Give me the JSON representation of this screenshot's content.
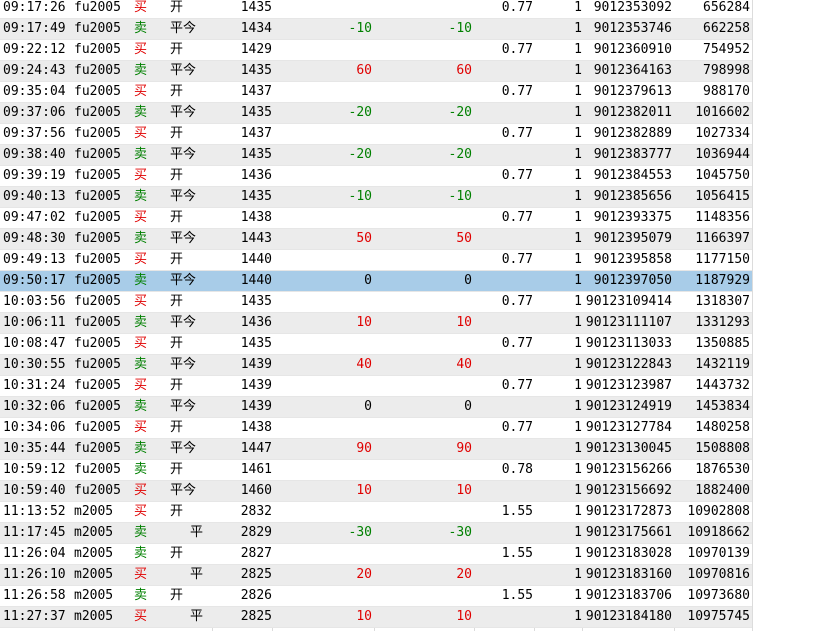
{
  "columns_visible": [
    "time",
    "symbol",
    "direction",
    "action",
    "price",
    "change_a",
    "change_b",
    "fee",
    "qty",
    "order_id",
    "cumulative"
  ],
  "colors": {
    "buy": "#e00000",
    "sell": "#008000",
    "selected_row": "#a8cce8",
    "stripe": "#ececec"
  },
  "rows": [
    {
      "time": "09:17:26",
      "symbol": "fu2005",
      "dir": "买",
      "act": "开",
      "price": "1435",
      "chg1": "",
      "chg2": "",
      "fee": "0.77",
      "qty": "1",
      "oid": "9012353092",
      "acc": "656284"
    },
    {
      "time": "09:17:49",
      "symbol": "fu2005",
      "dir": "卖",
      "act": "平今",
      "price": "1434",
      "chg1": "-10",
      "chg2": "-10",
      "fee": "",
      "qty": "1",
      "oid": "9012353746",
      "acc": "662258"
    },
    {
      "time": "09:22:12",
      "symbol": "fu2005",
      "dir": "买",
      "act": "开",
      "price": "1429",
      "chg1": "",
      "chg2": "",
      "fee": "0.77",
      "qty": "1",
      "oid": "9012360910",
      "acc": "754952"
    },
    {
      "time": "09:24:43",
      "symbol": "fu2005",
      "dir": "卖",
      "act": "平今",
      "price": "1435",
      "chg1": "60",
      "chg2": "60",
      "fee": "",
      "qty": "1",
      "oid": "9012364163",
      "acc": "798998"
    },
    {
      "time": "09:35:04",
      "symbol": "fu2005",
      "dir": "买",
      "act": "开",
      "price": "1437",
      "chg1": "",
      "chg2": "",
      "fee": "0.77",
      "qty": "1",
      "oid": "9012379613",
      "acc": "988170"
    },
    {
      "time": "09:37:06",
      "symbol": "fu2005",
      "dir": "卖",
      "act": "平今",
      "price": "1435",
      "chg1": "-20",
      "chg2": "-20",
      "fee": "",
      "qty": "1",
      "oid": "9012382011",
      "acc": "1016602"
    },
    {
      "time": "09:37:56",
      "symbol": "fu2005",
      "dir": "买",
      "act": "开",
      "price": "1437",
      "chg1": "",
      "chg2": "",
      "fee": "0.77",
      "qty": "1",
      "oid": "9012382889",
      "acc": "1027334"
    },
    {
      "time": "09:38:40",
      "symbol": "fu2005",
      "dir": "卖",
      "act": "平今",
      "price": "1435",
      "chg1": "-20",
      "chg2": "-20",
      "fee": "",
      "qty": "1",
      "oid": "9012383777",
      "acc": "1036944"
    },
    {
      "time": "09:39:19",
      "symbol": "fu2005",
      "dir": "买",
      "act": "开",
      "price": "1436",
      "chg1": "",
      "chg2": "",
      "fee": "0.77",
      "qty": "1",
      "oid": "9012384553",
      "acc": "1045750"
    },
    {
      "time": "09:40:13",
      "symbol": "fu2005",
      "dir": "卖",
      "act": "平今",
      "price": "1435",
      "chg1": "-10",
      "chg2": "-10",
      "fee": "",
      "qty": "1",
      "oid": "9012385656",
      "acc": "1056415"
    },
    {
      "time": "09:47:02",
      "symbol": "fu2005",
      "dir": "买",
      "act": "开",
      "price": "1438",
      "chg1": "",
      "chg2": "",
      "fee": "0.77",
      "qty": "1",
      "oid": "9012393375",
      "acc": "1148356"
    },
    {
      "time": "09:48:30",
      "symbol": "fu2005",
      "dir": "卖",
      "act": "平今",
      "price": "1443",
      "chg1": "50",
      "chg2": "50",
      "fee": "",
      "qty": "1",
      "oid": "9012395079",
      "acc": "1166397"
    },
    {
      "time": "09:49:13",
      "symbol": "fu2005",
      "dir": "买",
      "act": "开",
      "price": "1440",
      "chg1": "",
      "chg2": "",
      "fee": "0.77",
      "qty": "1",
      "oid": "9012395858",
      "acc": "1177150"
    },
    {
      "time": "09:50:17",
      "symbol": "fu2005",
      "dir": "卖",
      "act": "平今",
      "price": "1440",
      "chg1": "0",
      "chg2": "0",
      "fee": "",
      "qty": "1",
      "oid": "9012397050",
      "acc": "1187929",
      "selected": true
    },
    {
      "time": "10:03:56",
      "symbol": "fu2005",
      "dir": "买",
      "act": "开",
      "price": "1435",
      "chg1": "",
      "chg2": "",
      "fee": "0.77",
      "qty": "1",
      "oid": "90123109414",
      "acc": "1318307"
    },
    {
      "time": "10:06:11",
      "symbol": "fu2005",
      "dir": "卖",
      "act": "平今",
      "price": "1436",
      "chg1": "10",
      "chg2": "10",
      "fee": "",
      "qty": "1",
      "oid": "90123111107",
      "acc": "1331293"
    },
    {
      "time": "10:08:47",
      "symbol": "fu2005",
      "dir": "买",
      "act": "开",
      "price": "1435",
      "chg1": "",
      "chg2": "",
      "fee": "0.77",
      "qty": "1",
      "oid": "90123113033",
      "acc": "1350885"
    },
    {
      "time": "10:30:55",
      "symbol": "fu2005",
      "dir": "卖",
      "act": "平今",
      "price": "1439",
      "chg1": "40",
      "chg2": "40",
      "fee": "",
      "qty": "1",
      "oid": "90123122843",
      "acc": "1432119"
    },
    {
      "time": "10:31:24",
      "symbol": "fu2005",
      "dir": "买",
      "act": "开",
      "price": "1439",
      "chg1": "",
      "chg2": "",
      "fee": "0.77",
      "qty": "1",
      "oid": "90123123987",
      "acc": "1443732"
    },
    {
      "time": "10:32:06",
      "symbol": "fu2005",
      "dir": "卖",
      "act": "平今",
      "price": "1439",
      "chg1": "0",
      "chg2": "0",
      "fee": "",
      "qty": "1",
      "oid": "90123124919",
      "acc": "1453834"
    },
    {
      "time": "10:34:06",
      "symbol": "fu2005",
      "dir": "买",
      "act": "开",
      "price": "1438",
      "chg1": "",
      "chg2": "",
      "fee": "0.77",
      "qty": "1",
      "oid": "90123127784",
      "acc": "1480258"
    },
    {
      "time": "10:35:44",
      "symbol": "fu2005",
      "dir": "卖",
      "act": "平今",
      "price": "1447",
      "chg1": "90",
      "chg2": "90",
      "fee": "",
      "qty": "1",
      "oid": "90123130045",
      "acc": "1508808"
    },
    {
      "time": "10:59:12",
      "symbol": "fu2005",
      "dir": "卖",
      "act": "开",
      "price": "1461",
      "chg1": "",
      "chg2": "",
      "fee": "0.78",
      "qty": "1",
      "oid": "90123156266",
      "acc": "1876530"
    },
    {
      "time": "10:59:40",
      "symbol": "fu2005",
      "dir": "买",
      "act": "平今",
      "price": "1460",
      "chg1": "10",
      "chg2": "10",
      "fee": "",
      "qty": "1",
      "oid": "90123156692",
      "acc": "1882400"
    },
    {
      "time": "11:13:52",
      "symbol": "m2005",
      "dir": "买",
      "act": "开",
      "price": "2832",
      "chg1": "",
      "chg2": "",
      "fee": "1.55",
      "qty": "1",
      "oid": "90123172873",
      "acc": "10902808"
    },
    {
      "time": "11:17:45",
      "symbol": "m2005",
      "dir": "卖",
      "act": "平",
      "price": "2829",
      "chg1": "-30",
      "chg2": "-30",
      "fee": "",
      "qty": "1",
      "oid": "90123175661",
      "acc": "10918662"
    },
    {
      "time": "11:26:04",
      "symbol": "m2005",
      "dir": "卖",
      "act": "开",
      "price": "2827",
      "chg1": "",
      "chg2": "",
      "fee": "1.55",
      "qty": "1",
      "oid": "90123183028",
      "acc": "10970139"
    },
    {
      "time": "11:26:10",
      "symbol": "m2005",
      "dir": "买",
      "act": "平",
      "price": "2825",
      "chg1": "20",
      "chg2": "20",
      "fee": "",
      "qty": "1",
      "oid": "90123183160",
      "acc": "10970816"
    },
    {
      "time": "11:26:58",
      "symbol": "m2005",
      "dir": "卖",
      "act": "开",
      "price": "2826",
      "chg1": "",
      "chg2": "",
      "fee": "1.55",
      "qty": "1",
      "oid": "90123183706",
      "acc": "10973680"
    },
    {
      "time": "11:27:37",
      "symbol": "m2005",
      "dir": "买",
      "act": "平",
      "price": "2825",
      "chg1": "10",
      "chg2": "10",
      "fee": "",
      "qty": "1",
      "oid": "90123184180",
      "acc": "10975745"
    }
  ]
}
